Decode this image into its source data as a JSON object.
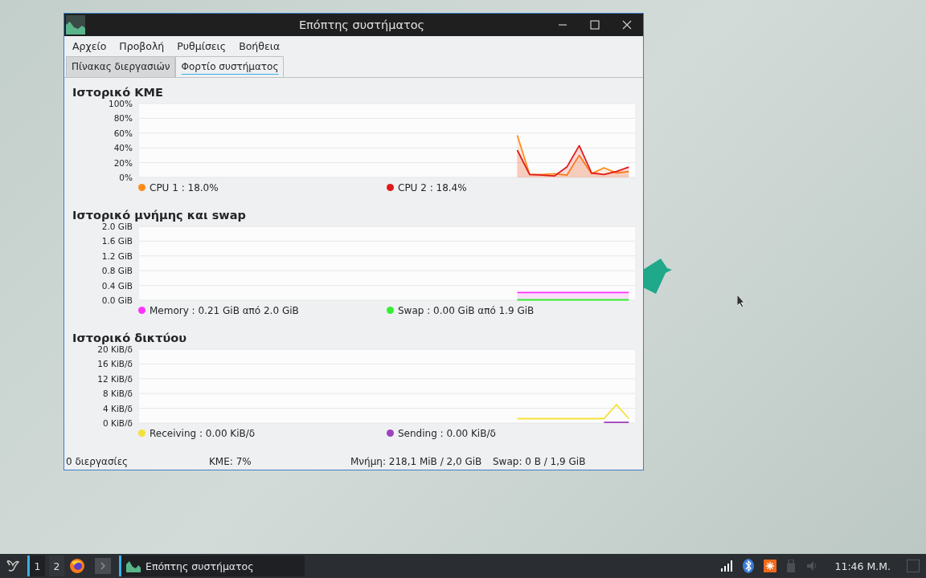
{
  "window": {
    "title": "Επόπτης συστήματος"
  },
  "menu": [
    "Αρχείο",
    "Προβολή",
    "Ρυθμίσεις",
    "Βοήθεια"
  ],
  "tabs": [
    {
      "label": "Πίνακας διεργασιών",
      "selected": false
    },
    {
      "label": "Φορτίο συστήματος",
      "selected": true
    }
  ],
  "sections": [
    {
      "title": "Ιστορικό ΚΜΕ",
      "legend_values": [
        ": 18.0%",
        ": 18.4%"
      ],
      "chart_data": {
        "type": "area",
        "categories": [
          null,
          null,
          null,
          null,
          null,
          null,
          null,
          null,
          null,
          null,
          null,
          null,
          null,
          null,
          null,
          null,
          null,
          null,
          null,
          null,
          null,
          null,
          null,
          null,
          null,
          null,
          null,
          null,
          null,
          null,
          null,
          null,
          null,
          null,
          null,
          null,
          null,
          null,
          null,
          null
        ],
        "ylim": [
          0,
          100
        ],
        "grid": true,
        "yticks": [
          {
            "value": 0,
            "label": "0%"
          },
          {
            "value": 20,
            "label": "20%"
          },
          {
            "value": 40,
            "label": "40%"
          },
          {
            "value": 60,
            "label": "60%"
          },
          {
            "value": 80,
            "label": "80%"
          },
          {
            "value": 100,
            "label": "100%"
          }
        ],
        "series": [
          {
            "name": "CPU 1",
            "color": "#ff8c1a",
            "values": [
              null,
              null,
              null,
              null,
              null,
              null,
              null,
              null,
              null,
              null,
              null,
              null,
              null,
              null,
              null,
              null,
              null,
              null,
              null,
              null,
              null,
              null,
              null,
              null,
              null,
              null,
              null,
              null,
              null,
              null,
              57,
              4,
              4,
              5,
              3,
              30,
              5,
              13,
              6,
              8
            ]
          },
          {
            "name": "CPU 2",
            "color": "#e01b1b",
            "values": [
              null,
              null,
              null,
              null,
              null,
              null,
              null,
              null,
              null,
              null,
              null,
              null,
              null,
              null,
              null,
              null,
              null,
              null,
              null,
              null,
              null,
              null,
              null,
              null,
              null,
              null,
              null,
              null,
              null,
              null,
              37,
              4,
              3,
              2,
              14,
              43,
              6,
              4,
              8,
              14
            ]
          }
        ]
      }
    },
    {
      "title": "Ιστορικό μνήμης και swap",
      "legend_values": [
        ": 0.21 GiB από 2.0 GiB",
        ": 0.00 GiB από 1.9 GiB"
      ],
      "chart_data": {
        "type": "area",
        "categories": [
          null,
          null,
          null,
          null,
          null,
          null,
          null,
          null,
          null,
          null,
          null,
          null,
          null,
          null,
          null,
          null,
          null,
          null,
          null,
          null,
          null,
          null,
          null,
          null,
          null,
          null,
          null,
          null,
          null,
          null,
          null,
          null,
          null,
          null,
          null,
          null,
          null,
          null,
          null,
          null
        ],
        "ylim": [
          0,
          2
        ],
        "grid": true,
        "yticks": [
          {
            "value": 0,
            "label": "0.0 GiB"
          },
          {
            "value": 0.4,
            "label": "0.4 GiB"
          },
          {
            "value": 0.8,
            "label": "0.8 GiB"
          },
          {
            "value": 1.2,
            "label": "1.2 GiB"
          },
          {
            "value": 1.6,
            "label": "1.6 GiB"
          },
          {
            "value": 2,
            "label": "2.0 GiB"
          }
        ],
        "series": [
          {
            "name": "Memory",
            "color": "#ff33ff",
            "values": [
              null,
              null,
              null,
              null,
              null,
              null,
              null,
              null,
              null,
              null,
              null,
              null,
              null,
              null,
              null,
              null,
              null,
              null,
              null,
              null,
              null,
              null,
              null,
              null,
              null,
              null,
              null,
              null,
              null,
              null,
              0.21,
              0.21,
              0.21,
              0.21,
              0.21,
              0.21,
              0.21,
              0.21,
              0.21,
              0.21
            ]
          },
          {
            "name": "Swap",
            "color": "#33ee33",
            "values": [
              null,
              null,
              null,
              null,
              null,
              null,
              null,
              null,
              null,
              null,
              null,
              null,
              null,
              null,
              null,
              null,
              null,
              null,
              null,
              null,
              null,
              null,
              null,
              null,
              null,
              null,
              null,
              null,
              null,
              null,
              0.01,
              0.01,
              0.01,
              0.01,
              0.01,
              0.01,
              0.01,
              0.01,
              0.01,
              0.01
            ]
          }
        ]
      }
    },
    {
      "title": "Ιστορικό δικτύου",
      "legend_values": [
        ": 0.00 KiB/δ",
        ": 0.00 KiB/δ"
      ],
      "chart_data": {
        "type": "line",
        "categories": [
          null,
          null,
          null,
          null,
          null,
          null,
          null,
          null,
          null,
          null,
          null,
          null,
          null,
          null,
          null,
          null,
          null,
          null,
          null,
          null,
          null,
          null,
          null,
          null,
          null,
          null,
          null,
          null,
          null,
          null,
          null,
          null,
          null,
          null,
          null,
          null,
          null,
          null,
          null,
          null
        ],
        "ylim": [
          0,
          20
        ],
        "grid": true,
        "yticks": [
          {
            "value": 0,
            "label": "0 KiB/δ"
          },
          {
            "value": 4,
            "label": "4 KiB/δ"
          },
          {
            "value": 8,
            "label": "8 KiB/δ"
          },
          {
            "value": 12,
            "label": "12 KiB/δ"
          },
          {
            "value": 16,
            "label": "16 KiB/δ"
          },
          {
            "value": 20,
            "label": "20 KiB/δ"
          }
        ],
        "series": [
          {
            "name": "Receiving",
            "color": "#f5e13a",
            "values": [
              null,
              null,
              null,
              null,
              null,
              null,
              null,
              null,
              null,
              null,
              null,
              null,
              null,
              null,
              null,
              null,
              null,
              null,
              null,
              null,
              null,
              null,
              null,
              null,
              null,
              null,
              null,
              null,
              null,
              null,
              1.2,
              1.2,
              1.2,
              1.2,
              1.2,
              1.2,
              1.2,
              1.2,
              5,
              1.2
            ]
          },
          {
            "name": "Sending",
            "color": "#a040c0",
            "values": [
              null,
              null,
              null,
              null,
              null,
              null,
              null,
              null,
              null,
              null,
              null,
              null,
              null,
              null,
              null,
              null,
              null,
              null,
              null,
              null,
              null,
              null,
              null,
              null,
              null,
              null,
              null,
              null,
              null,
              null,
              null,
              null,
              null,
              null,
              null,
              null,
              null,
              0.2,
              0.2,
              0.2
            ]
          }
        ]
      }
    }
  ],
  "status_bar": [
    "0 διεργασίες",
    "ΚΜΕ: 7%",
    "Μνήμη: 218,1 MiB / 2,0 GiB",
    "Swap: 0 B / 1,9 GiB"
  ],
  "taskbar": {
    "workspaces": [
      {
        "label": "1",
        "selected": true
      },
      {
        "label": "2",
        "selected": false
      }
    ],
    "task": {
      "title": "Επόπτης συστήματος"
    },
    "clock": "11:46 Μ.Μ."
  }
}
